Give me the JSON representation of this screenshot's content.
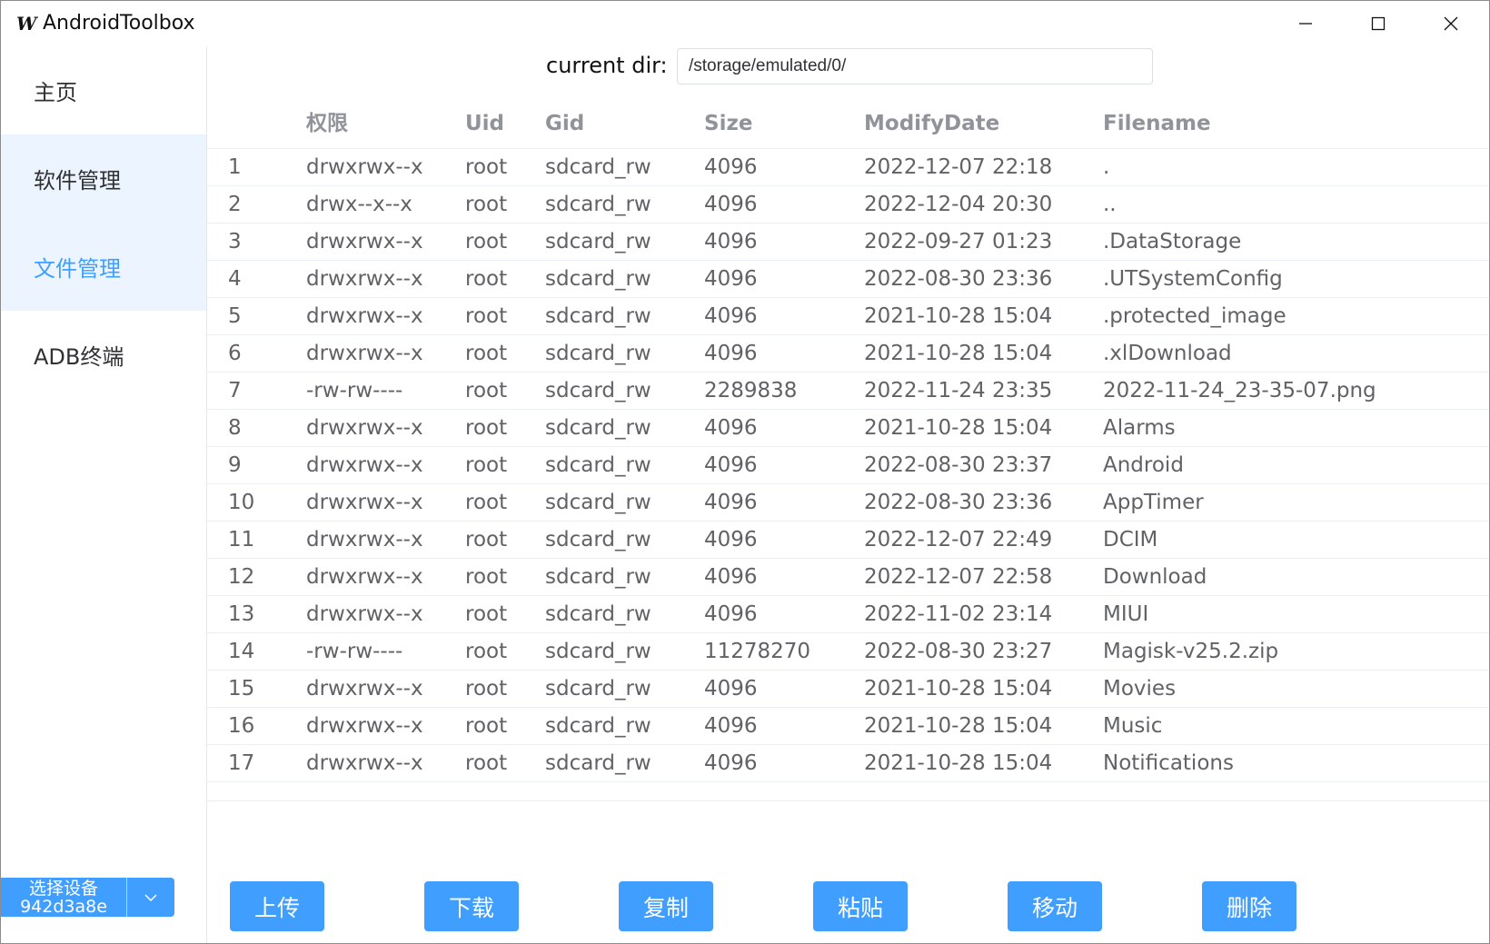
{
  "window": {
    "title": "AndroidToolbox",
    "logo_char": "W",
    "controls": [
      "minimize-icon",
      "maximize-icon",
      "close-icon"
    ]
  },
  "sidebar": {
    "items": [
      {
        "label": "主页"
      },
      {
        "label": "软件管理"
      },
      {
        "label": "文件管理",
        "active": true
      },
      {
        "label": "ADB终端"
      }
    ],
    "device": {
      "label": "选择设备",
      "serial": "942d3a8e"
    }
  },
  "explorer": {
    "dir_label": "current dir:",
    "dir_value": "/storage/emulated/0/"
  },
  "table": {
    "columns": [
      "",
      "权限",
      "Uid",
      "Gid",
      "Size",
      "ModifyDate",
      "Filename"
    ],
    "rows": [
      [
        "1",
        "drwxrwx--x",
        "root",
        "sdcard_rw",
        "4096",
        "2022-12-07 22:18",
        "."
      ],
      [
        "2",
        "drwx--x--x",
        "root",
        "sdcard_rw",
        "4096",
        "2022-12-04 20:30",
        ".."
      ],
      [
        "3",
        "drwxrwx--x",
        "root",
        "sdcard_rw",
        "4096",
        "2022-09-27 01:23",
        ".DataStorage"
      ],
      [
        "4",
        "drwxrwx--x",
        "root",
        "sdcard_rw",
        "4096",
        "2022-08-30 23:36",
        ".UTSystemConfig"
      ],
      [
        "5",
        "drwxrwx--x",
        "root",
        "sdcard_rw",
        "4096",
        "2021-10-28 15:04",
        ".protected_image"
      ],
      [
        "6",
        "drwxrwx--x",
        "root",
        "sdcard_rw",
        "4096",
        "2021-10-28 15:04",
        ".xlDownload"
      ],
      [
        "7",
        "-rw-rw----",
        "root",
        "sdcard_rw",
        "2289838",
        "2022-11-24 23:35",
        "2022-11-24_23-35-07.png"
      ],
      [
        "8",
        "drwxrwx--x",
        "root",
        "sdcard_rw",
        "4096",
        "2021-10-28 15:04",
        "Alarms"
      ],
      [
        "9",
        "drwxrwx--x",
        "root",
        "sdcard_rw",
        "4096",
        "2022-08-30 23:37",
        "Android"
      ],
      [
        "10",
        "drwxrwx--x",
        "root",
        "sdcard_rw",
        "4096",
        "2022-08-30 23:36",
        "AppTimer"
      ],
      [
        "11",
        "drwxrwx--x",
        "root",
        "sdcard_rw",
        "4096",
        "2022-12-07 22:49",
        "DCIM"
      ],
      [
        "12",
        "drwxrwx--x",
        "root",
        "sdcard_rw",
        "4096",
        "2022-12-07 22:58",
        "Download"
      ],
      [
        "13",
        "drwxrwx--x",
        "root",
        "sdcard_rw",
        "4096",
        "2022-11-02 23:14",
        "MIUI"
      ],
      [
        "14",
        "-rw-rw----",
        "root",
        "sdcard_rw",
        "11278270",
        "2022-08-30 23:27",
        "Magisk-v25.2.zip"
      ],
      [
        "15",
        "drwxrwx--x",
        "root",
        "sdcard_rw",
        "4096",
        "2021-10-28 15:04",
        "Movies"
      ],
      [
        "16",
        "drwxrwx--x",
        "root",
        "sdcard_rw",
        "4096",
        "2021-10-28 15:04",
        "Music"
      ],
      [
        "17",
        "drwxrwx--x",
        "root",
        "sdcard_rw",
        "4096",
        "2021-10-28 15:04",
        "Notifications"
      ]
    ]
  },
  "actions": {
    "upload": "上传",
    "download": "下载",
    "copy": "复制",
    "paste": "粘贴",
    "move": "移动",
    "delete": "删除"
  },
  "colors": {
    "accent": "#409eff",
    "active_bg": "#ecf5ff",
    "header_text": "#909399",
    "cell_text": "#606266"
  }
}
